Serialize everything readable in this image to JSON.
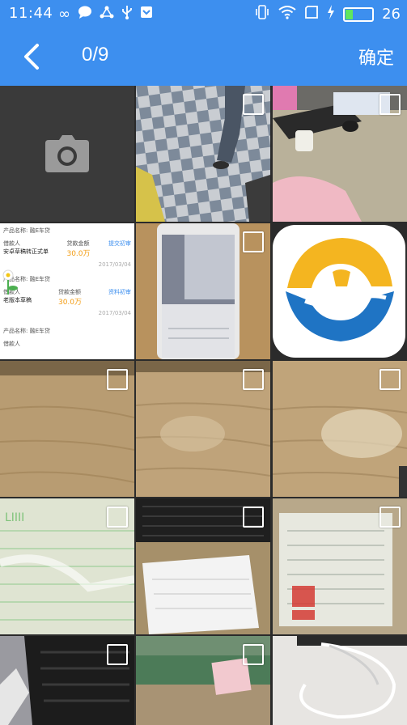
{
  "status_bar": {
    "time": "11:44",
    "battery_level": "26"
  },
  "toolbar": {
    "counter": "0/9",
    "confirm_label": "确定"
  },
  "colors": {
    "appbar": "#3d8fef",
    "grid_bg": "#2b2b2b",
    "camera_cell": "#3a3a3a"
  },
  "icons": [
    "back-arrow-icon",
    "camera-icon",
    "checkbox-icon"
  ],
  "list_items": [
    {
      "product_label": "产品名称:",
      "product": "融E车贷",
      "borrower_label": "借款人",
      "borrower": "安卓草稿转正式单",
      "amount_label": "贷款金额",
      "amount": "30.0万",
      "action": "提交初审",
      "date": "2017/03/04"
    },
    {
      "product_label": "产品名称:",
      "product": "融E车贷",
      "borrower_label": "借款人",
      "borrower": "老版本草稿",
      "amount_label": "贷款金额",
      "amount": "30.0万",
      "action": "资料初审",
      "date": "2017/03/04"
    },
    {
      "product_label": "产品名称:",
      "product": "融E车贷",
      "borrower_label": "借款人",
      "borrower": "",
      "amount_label": "贷款金额",
      "amount": "",
      "action": "",
      "date": ""
    }
  ]
}
